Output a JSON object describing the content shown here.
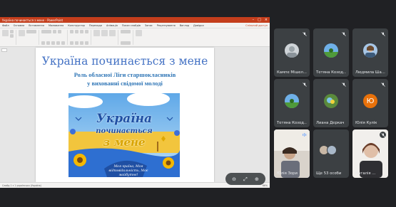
{
  "shared_window": {
    "title": "Україна починається з мене - PowerPoint",
    "menu": [
      "Файл",
      "Основна",
      "Вставлення",
      "Малювання",
      "Конструктор",
      "Переходи",
      "Анімація",
      "Показ слайдів",
      "Запис",
      "Рецензування",
      "Вигляд",
      "Довідка"
    ],
    "share_label": "Спільний доступ",
    "status_left": "Слайд 1 з 1   українська (Україна)",
    "zoom": "66%"
  },
  "slide": {
    "title": "Україна починається з мене",
    "subtitle_line1": "Роль обласної Ліги старшокласників",
    "subtitle_line2": "у вихованні свідомої молоді",
    "poster_title_a": "Україна",
    "poster_title_b": "починається",
    "poster_title_c": "з мене",
    "poster_slogan": "Моя країна, Моя відповідальність, Моє майбутнє!"
  },
  "participants": [
    {
      "name": "Кампе Мішел...",
      "avatar": "photo",
      "muted": true
    },
    {
      "name": "Тетяна Козод...",
      "avatar": "photo",
      "muted": true
    },
    {
      "name": "Людмила Ша...",
      "avatar": "photo",
      "muted": true
    },
    {
      "name": "Тетяна Козод...",
      "avatar": "photo",
      "muted": true
    },
    {
      "name": "Лиана Деркач",
      "avatar": "photo",
      "muted": true
    },
    {
      "name": "Юлія Кулік",
      "avatar": "letter",
      "letter": "Ю",
      "muted": true
    },
    {
      "name": "Юлія Зори",
      "avatar": "video",
      "muted": false
    },
    {
      "name": "Ще 53 особи",
      "avatar": "group",
      "muted": false
    },
    {
      "name": "Наталія ...",
      "avatar": "video",
      "muted": true
    }
  ],
  "colors": {
    "accent_orange": "#e8710a",
    "slide_title_blue": "#4472c4",
    "ppt_red": "#c43e1c",
    "tile_bg": "#3c4043"
  }
}
